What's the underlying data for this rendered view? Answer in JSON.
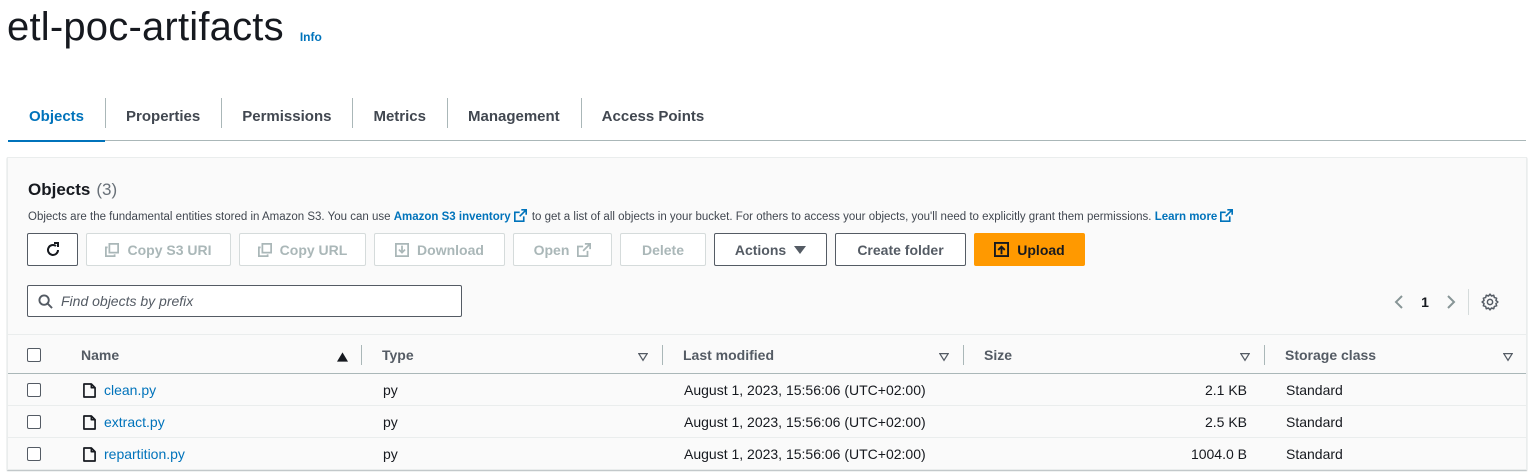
{
  "bucket": {
    "name": "etl-poc-artifacts",
    "info_label": "Info"
  },
  "tabs": [
    {
      "label": "Objects",
      "active": true
    },
    {
      "label": "Properties"
    },
    {
      "label": "Permissions"
    },
    {
      "label": "Metrics"
    },
    {
      "label": "Management"
    },
    {
      "label": "Access Points"
    }
  ],
  "objects_panel": {
    "title": "Objects",
    "count": "(3)",
    "description_prefix": "Objects are the fundamental entities stored in Amazon S3. You can use ",
    "inventory_link": "Amazon S3 inventory",
    "description_middle": " to get a list of all objects in your bucket. For others to access your objects, you'll need to explicitly grant them permissions. ",
    "learn_more_link": "Learn more"
  },
  "toolbar": {
    "copy_s3_uri": "Copy S3 URI",
    "copy_url": "Copy URL",
    "download": "Download",
    "open": "Open",
    "delete": "Delete",
    "actions": "Actions",
    "create_folder": "Create folder",
    "upload": "Upload"
  },
  "search": {
    "placeholder": "Find objects by prefix",
    "value": ""
  },
  "pagination": {
    "current_page": "1"
  },
  "table": {
    "headers": {
      "name": "Name",
      "type": "Type",
      "last_modified": "Last modified",
      "size": "Size",
      "storage_class": "Storage class"
    },
    "rows": [
      {
        "name": "clean.py",
        "type": "py",
        "last_modified": "August 1, 2023, 15:56:06 (UTC+02:00)",
        "size": "2.1 KB",
        "storage_class": "Standard"
      },
      {
        "name": "extract.py",
        "type": "py",
        "last_modified": "August 1, 2023, 15:56:06 (UTC+02:00)",
        "size": "2.5 KB",
        "storage_class": "Standard"
      },
      {
        "name": "repartition.py",
        "type": "py",
        "last_modified": "August 1, 2023, 15:56:06 (UTC+02:00)",
        "size": "1004.0 B",
        "storage_class": "Standard"
      }
    ]
  },
  "colors": {
    "link": "#0073bb",
    "upload_bg": "#ff9900",
    "active_tab": "#0073bb"
  }
}
